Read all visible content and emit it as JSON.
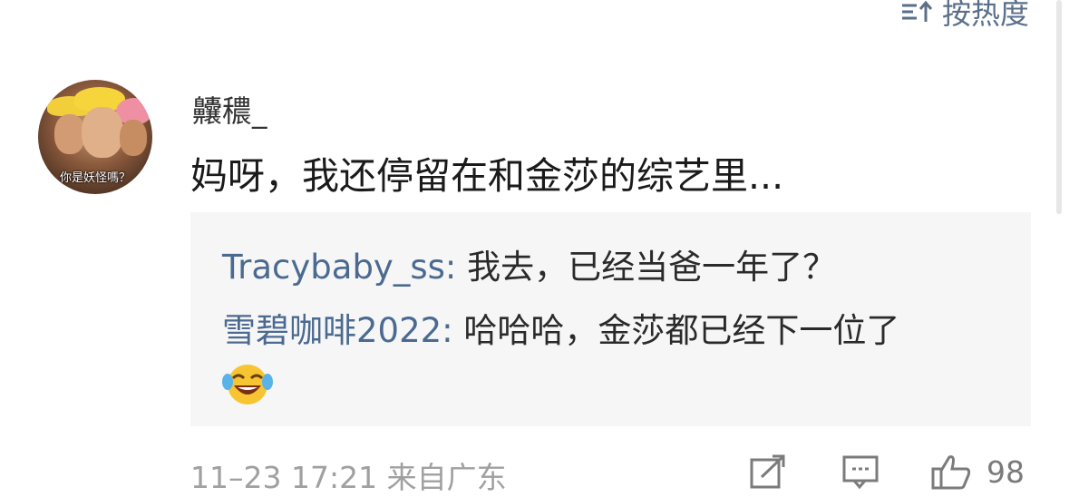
{
  "sort": {
    "label": "按热度",
    "icon": "sort-icon"
  },
  "comment": {
    "avatar_caption": "你是妖怪嗎？",
    "username": "齉穠_",
    "text": "妈呀，我还停留在和金莎的综艺里...",
    "replies": [
      {
        "name": "Tracybaby_ss:",
        "text": " 我去，已经当爸一年了？"
      },
      {
        "name": "雪碧咖啡2022:",
        "text": " 哈哈哈，金莎都已经下一位了",
        "emoji": "laughing-tears-emoji"
      }
    ],
    "time": "11–23 17:21 来自广东",
    "actions": {
      "share_icon": "share-icon",
      "comment_icon": "comment-icon",
      "like_icon": "thumbs-up-icon",
      "like_count": "98"
    }
  },
  "colors": {
    "link": "#4b6a91",
    "reply_bg": "#f6f6f6",
    "meta": "#a0a0a0"
  }
}
